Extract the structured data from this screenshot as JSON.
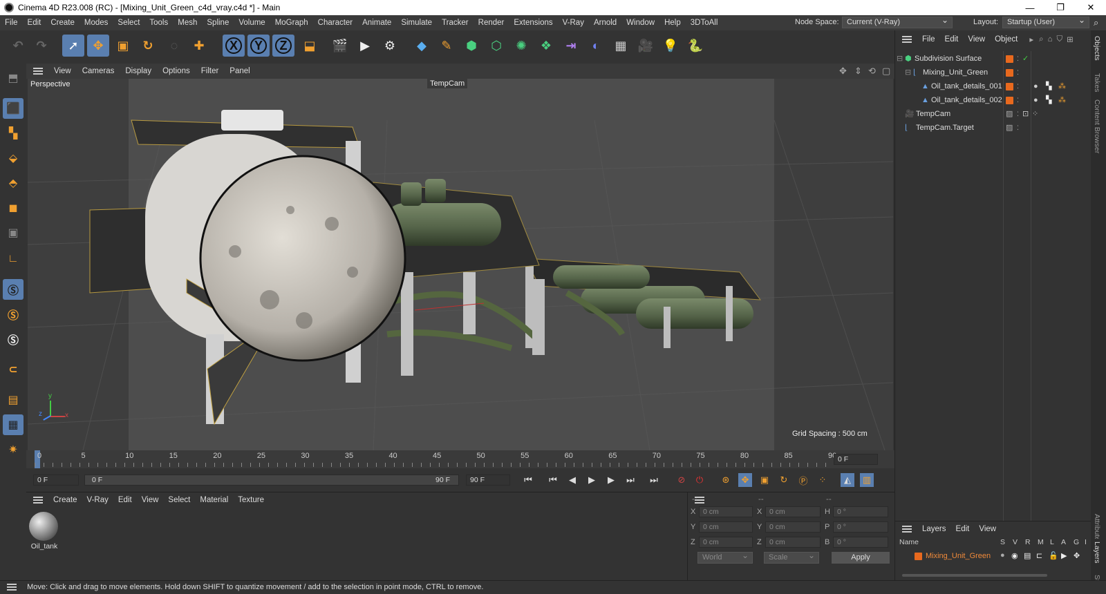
{
  "window": {
    "title": "Cinema 4D R23.008 (RC) - [Mixing_Unit_Green_c4d_vray.c4d *] - Main",
    "minimize": "—",
    "restore": "❐",
    "close": "✕"
  },
  "menu": [
    "File",
    "Edit",
    "Create",
    "Modes",
    "Select",
    "Tools",
    "Mesh",
    "Spline",
    "Volume",
    "MoGraph",
    "Character",
    "Animate",
    "Simulate",
    "Tracker",
    "Render",
    "Extensions",
    "V-Ray",
    "Arnold",
    "Window",
    "Help",
    "3DToAll"
  ],
  "node_space": {
    "label": "Node Space:",
    "value": "Current (V-Ray)"
  },
  "layout": {
    "label": "Layout:",
    "value": "Startup (User)"
  },
  "toolbar": {
    "axis_x": "X",
    "axis_y": "Y",
    "axis_z": "Z"
  },
  "viewport": {
    "menu": [
      "View",
      "Cameras",
      "Display",
      "Options",
      "Filter",
      "Panel"
    ],
    "name": "Perspective",
    "camera": "TempCam",
    "grid_spacing": "Grid Spacing : 500 cm",
    "axis_y": "y",
    "axis_z": "z",
    "axis_x": "x"
  },
  "timeline": {
    "ticks": [
      "0",
      "5",
      "10",
      "15",
      "20",
      "25",
      "30",
      "35",
      "40",
      "45",
      "50",
      "55",
      "60",
      "65",
      "70",
      "75",
      "80",
      "85",
      "90"
    ],
    "current": "0 F"
  },
  "transport": {
    "start": "0 F",
    "range_start": "0 F",
    "range_end": "90 F",
    "end": "90 F"
  },
  "material_manager": {
    "menu": [
      "Create",
      "V-Ray",
      "Edit",
      "View",
      "Select",
      "Material",
      "Texture"
    ],
    "materials": [
      {
        "name": "Oil_tank"
      }
    ]
  },
  "coordinates": {
    "headers": [
      "--",
      "--",
      "--"
    ],
    "pos": [
      {
        "axis": "X",
        "value": "0 cm"
      },
      {
        "axis": "Y",
        "value": "0 cm"
      },
      {
        "axis": "Z",
        "value": "0 cm"
      }
    ],
    "size": [
      {
        "axis": "X",
        "value": "0 cm"
      },
      {
        "axis": "Y",
        "value": "0 cm"
      },
      {
        "axis": "Z",
        "value": "0 cm"
      }
    ],
    "rot": [
      {
        "axis": "H",
        "value": "0 °"
      },
      {
        "axis": "P",
        "value": "0 °"
      },
      {
        "axis": "B",
        "value": "0 °"
      }
    ],
    "mode": "World",
    "scale": "Scale",
    "apply": "Apply"
  },
  "objects_panel": {
    "menu": [
      "File",
      "Edit",
      "View",
      "Object"
    ],
    "items": [
      {
        "name": "Subdivision Surface"
      },
      {
        "name": "Mixing_Unit_Green"
      },
      {
        "name": "Oil_tank_details_001"
      },
      {
        "name": "Oil_tank_details_002"
      },
      {
        "name": "TempCam"
      },
      {
        "name": "TempCam.Target"
      }
    ]
  },
  "layers_panel": {
    "menu": [
      "Layers",
      "Edit",
      "View"
    ],
    "columns": [
      "Name",
      "S",
      "V",
      "R",
      "M",
      "L",
      "A",
      "G",
      "I"
    ],
    "rows": [
      {
        "name": "Mixing_Unit_Green"
      }
    ]
  },
  "side_tabs": [
    "Objects",
    "Takes",
    "Content Browser",
    "Attributes",
    "Layers",
    "Structure"
  ],
  "status": "Move: Click and drag to move elements. Hold down SHIFT to quantize movement / add to the selection in point mode, CTRL to remove.",
  "colors": {
    "accent": "#5a7fb0",
    "orange": "#e8691e",
    "layer": "#e08a2a"
  }
}
